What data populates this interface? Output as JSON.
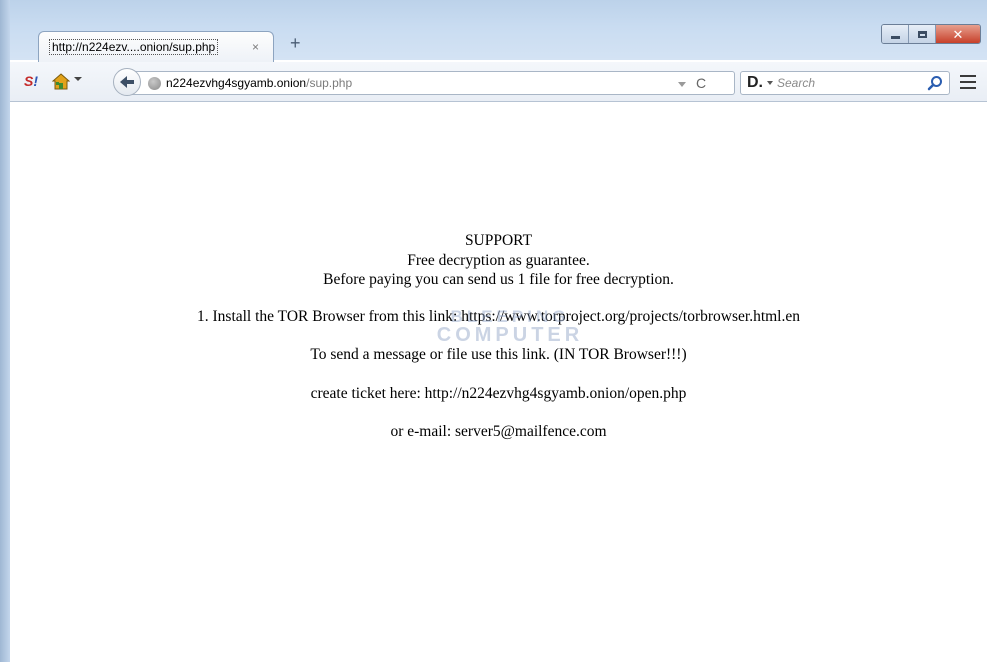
{
  "browser": {
    "tab": {
      "title": "http://n224ezv....onion/sup.php",
      "close_glyph": "×"
    },
    "new_tab_glyph": "+",
    "window_buttons": [
      "minimize",
      "maximize",
      "close"
    ],
    "address": {
      "host": "n224ezvhg4sgyamb.onion",
      "path": "/sup.php"
    },
    "reload_glyph": "C",
    "search": {
      "engine_label": "D.",
      "placeholder": "Search"
    },
    "toolbar_icons": [
      "s-addon-icon",
      "home-icon",
      "back-icon",
      "globe-icon",
      "reload-icon",
      "magnifier-icon",
      "hamburger-menu-icon"
    ]
  },
  "page": {
    "heading": "SUPPORT",
    "line1": "Free decryption as guarantee.",
    "line2": "Before paying you can send us 1 file for free decryption.",
    "step1": "1. Install the TOR Browser from this link: https://www.torproject.org/projects/torbrowser.html.en",
    "message_line": "To send a message or file use this link. (IN TOR Browser!!!)",
    "ticket_line": "create ticket here: http://n224ezvhg4sgyamb.onion/open.php",
    "email_line": "or e-mail: server5@mailfence.com"
  },
  "watermark": {
    "line1": "BLEEPING",
    "line2": "COMPUTER"
  }
}
